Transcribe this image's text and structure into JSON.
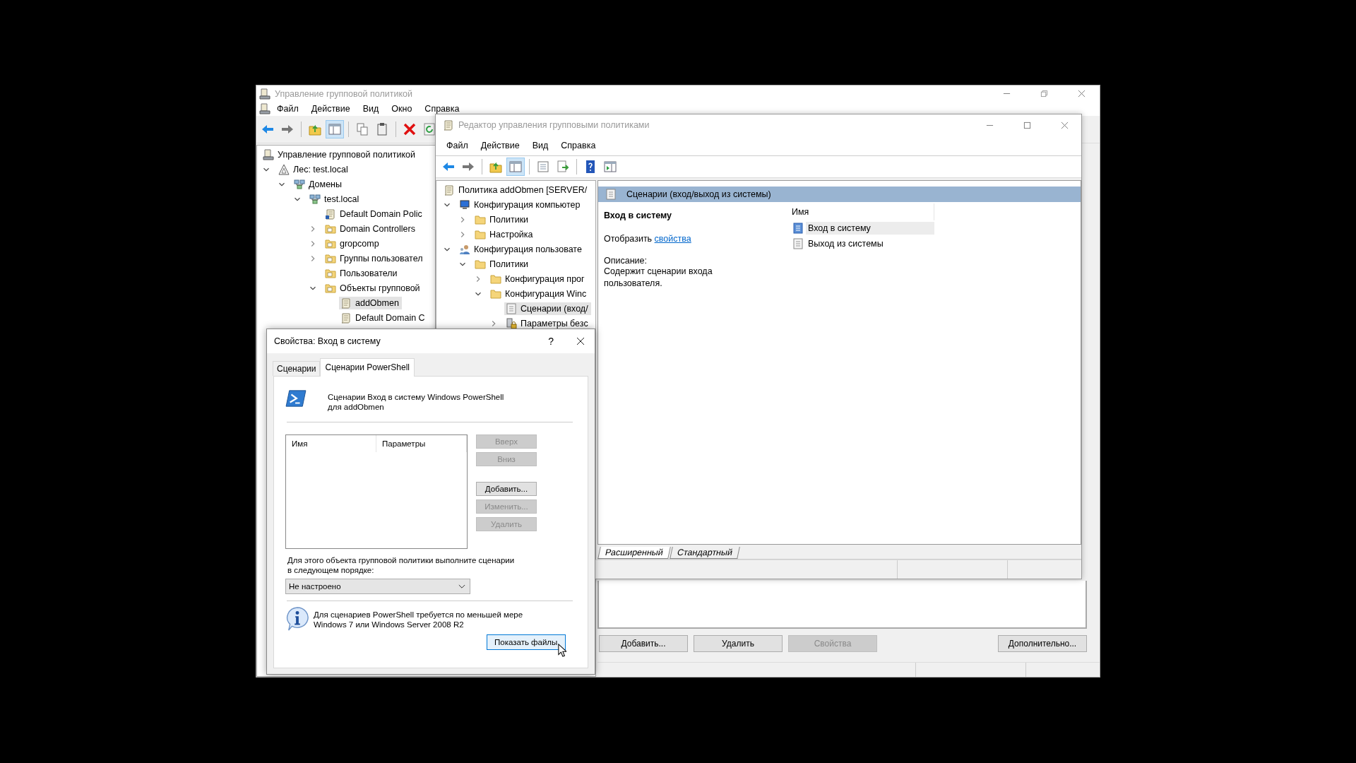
{
  "gpmc_window": {
    "title": "Управление групповой политикой",
    "menu": [
      "Файл",
      "Действие",
      "Вид",
      "Окно",
      "Справка"
    ],
    "tree": [
      {
        "label": "Управление групповой политикой",
        "kind": "console",
        "selected": false,
        "children": [
          {
            "label": "Лес: test.local",
            "kind": "forest",
            "expanded": true,
            "selected": false,
            "children": [
              {
                "label": "Домены",
                "kind": "domains",
                "expanded": true,
                "selected": false,
                "children": [
                  {
                    "label": "test.local",
                    "kind": "domain",
                    "expanded": true,
                    "selected": false,
                    "children": [
                      {
                        "label": "Default Domain Polic",
                        "kind": "gpo_link",
                        "selected": false
                      },
                      {
                        "label": "Domain Controllers",
                        "kind": "ou",
                        "expanded": false,
                        "selected": false
                      },
                      {
                        "label": "gropcomp",
                        "kind": "ou",
                        "expanded": false,
                        "selected": false
                      },
                      {
                        "label": "Группы пользовател",
                        "kind": "ou",
                        "expanded": false,
                        "selected": false
                      },
                      {
                        "label": "Пользователи",
                        "kind": "ou",
                        "selected": false
                      },
                      {
                        "label": "Объекты групповой",
                        "kind": "gpo_folder",
                        "expanded": true,
                        "selected": false,
                        "children": [
                          {
                            "label": "addObmen",
                            "kind": "gpo",
                            "selected": true
                          },
                          {
                            "label": "Default Domain C",
                            "kind": "gpo",
                            "selected": false
                          }
                        ]
                      }
                    ]
                  }
                ]
              }
            ]
          }
        ]
      }
    ],
    "buttons": [
      {
        "label": "Добавить...",
        "disabled": false
      },
      {
        "label": "Удалить",
        "disabled": false
      },
      {
        "label": "Свойства",
        "disabled": true
      },
      {
        "label": "Дополнительно...",
        "disabled": false
      }
    ]
  },
  "editor_window": {
    "title": "Редактор управления групповыми политиками",
    "menu": [
      "Файл",
      "Действие",
      "Вид",
      "Справка"
    ],
    "tree": [
      {
        "label": "Политика addObmen [SERVER/",
        "kind": "gpo",
        "selected": false,
        "children": [
          {
            "label": "Конфигурация компьютер",
            "kind": "computer",
            "expanded": true,
            "selected": false,
            "children": [
              {
                "label": "Политики",
                "kind": "folder",
                "expanded": false,
                "selected": false
              },
              {
                "label": "Настройка",
                "kind": "folder",
                "expanded": false,
                "selected": false
              }
            ]
          },
          {
            "label": "Конфигурация пользовате",
            "kind": "user",
            "expanded": true,
            "selected": false,
            "children": [
              {
                "label": "Политики",
                "kind": "folder",
                "expanded": true,
                "selected": false,
                "children": [
                  {
                    "label": "Конфигурация прог",
                    "kind": "folder",
                    "expanded": false,
                    "selected": false
                  },
                  {
                    "label": "Конфигурация Winc",
                    "kind": "folder",
                    "expanded": true,
                    "selected": false,
                    "children": [
                      {
                        "label": "Сценарии (вход/",
                        "kind": "script",
                        "selected": true
                      },
                      {
                        "label": "Параметры безс",
                        "kind": "security",
                        "expanded": false,
                        "selected": false
                      }
                    ]
                  }
                ]
              }
            ]
          }
        ]
      }
    ],
    "pane_title": "Сценарии (вход/выход из системы)",
    "detail": {
      "heading": "Вход в систему",
      "show_prefix": "Отобразить",
      "show_link": "свойства",
      "description_label": "Описание:",
      "description": "Содержит сценарии входа пользователя."
    },
    "list_header": "Имя",
    "list_items": [
      {
        "label": "Вход в систему",
        "selected": true
      },
      {
        "label": "Выход из системы",
        "selected": false
      }
    ],
    "view_tabs": [
      {
        "label": "Расширенный",
        "selected": true
      },
      {
        "label": "Стандартный",
        "selected": false
      }
    ]
  },
  "dialog": {
    "title": "Свойства: Вход в систему",
    "help": "?",
    "tabs": [
      {
        "label": "Сценарии",
        "selected": false
      },
      {
        "label": "Сценарии PowerShell",
        "selected": true
      }
    ],
    "heading": "Сценарии Вход в систему Windows PowerShell для addObmen",
    "columns": [
      "Имя",
      "Параметры"
    ],
    "side_buttons": [
      {
        "label": "Вверх",
        "disabled": true
      },
      {
        "label": "Вниз",
        "disabled": true
      },
      {
        "label": "Добавить...",
        "disabled": false
      },
      {
        "label": "Изменить...",
        "disabled": true
      },
      {
        "label": "Удалить",
        "disabled": true
      }
    ],
    "order_label": "Для этого объекта групповой политики выполните сценарии в следующем порядке:",
    "order_select": "Не настроено",
    "info": "Для сценариев PowerShell требуется по меньшей мере Windows 7 или Windows Server 2008 R2",
    "show_files_button": "Показать файлы"
  }
}
